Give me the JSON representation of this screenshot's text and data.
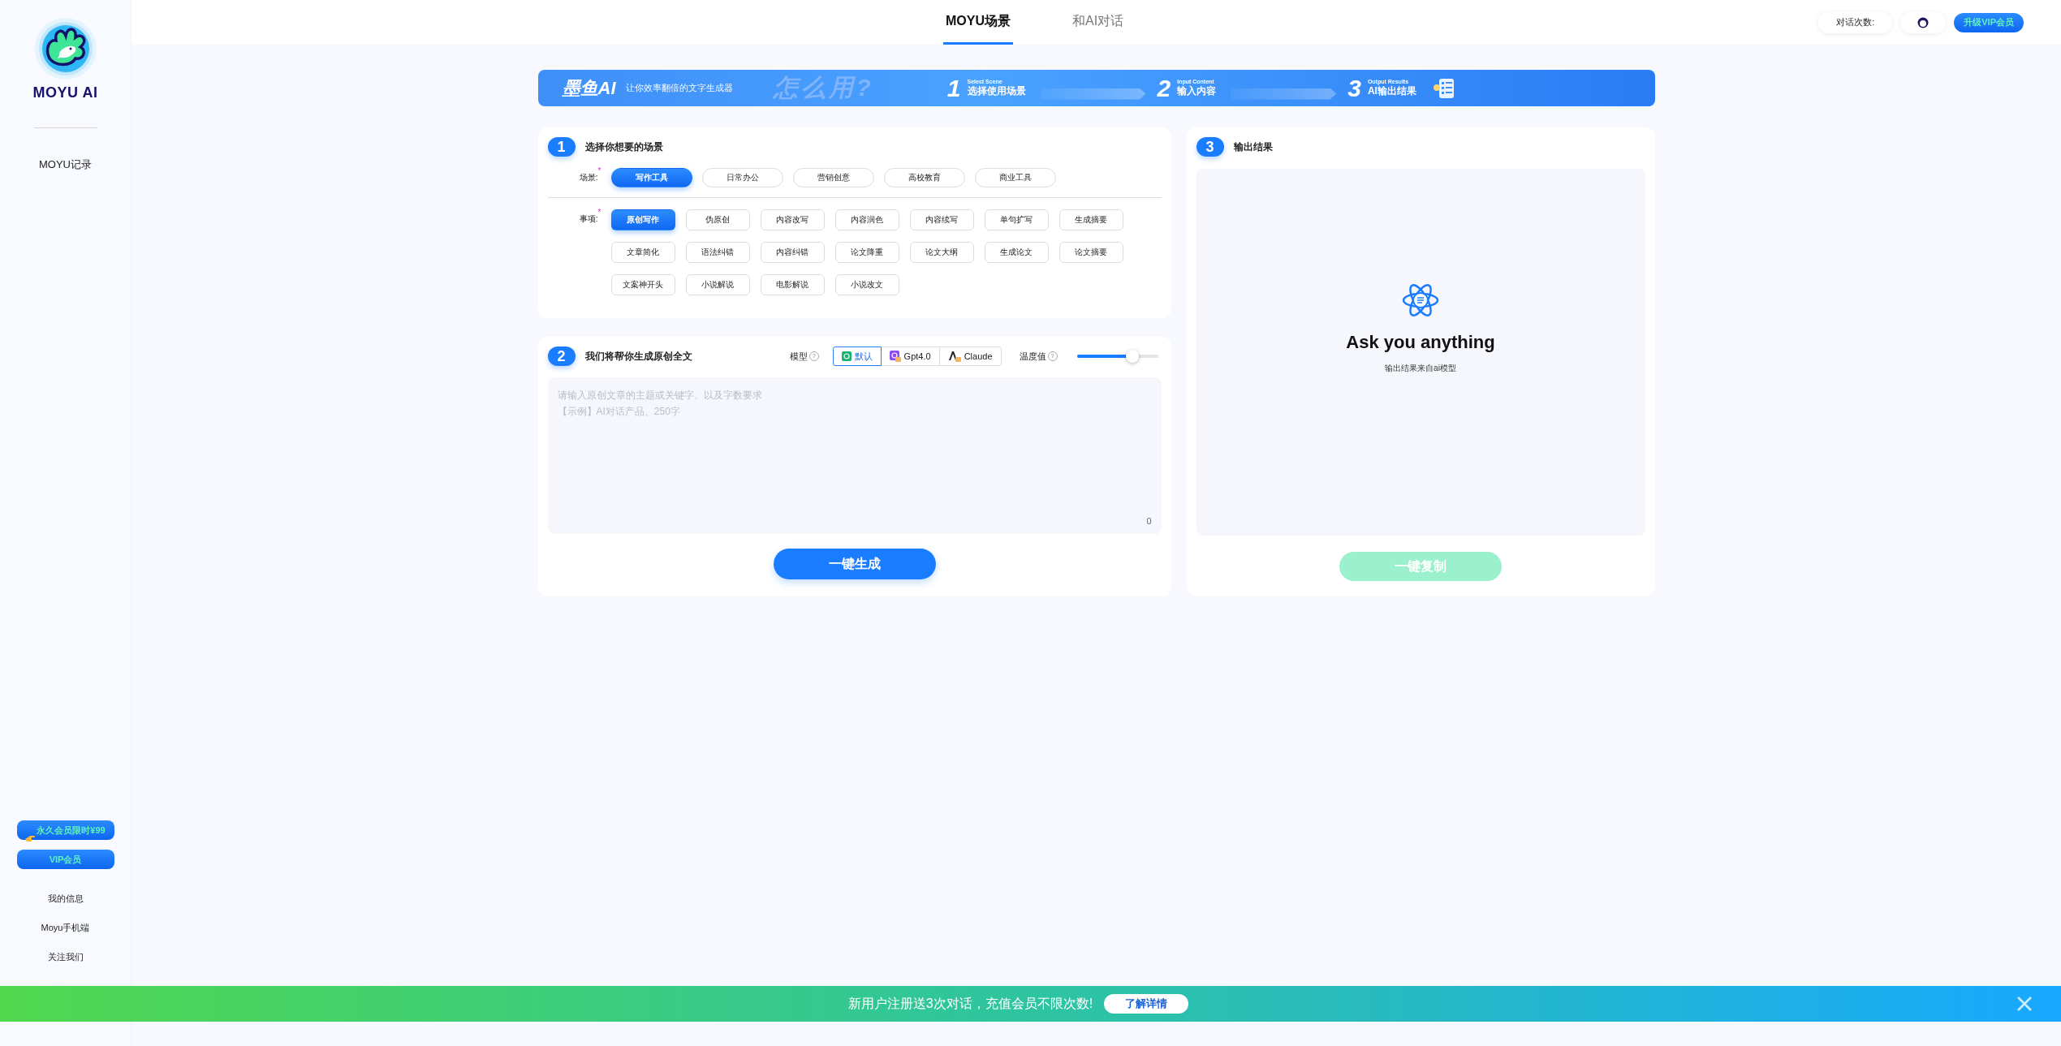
{
  "sidebar": {
    "logo_text": "MOYU AI",
    "items": [
      {
        "label": "MOYU记录"
      }
    ],
    "promo_buttons": [
      {
        "label": "永久会员限时¥99",
        "kind": "pointer"
      },
      {
        "label": "VIP会员",
        "kind": "plain"
      }
    ],
    "links": [
      "我的信息",
      "Moyu手机端",
      "关注我们"
    ]
  },
  "header": {
    "tabs": [
      {
        "label": "MOYU场景",
        "selected": true
      },
      {
        "label": "和AI对话",
        "selected": false
      }
    ],
    "chat_count_label": "对话次数:",
    "upgrade_button": "升级VIP会员"
  },
  "banner": {
    "brand": "墨鱼AI",
    "tagline": "让你效率翻倍的文字生成器",
    "how_to": "怎么用?",
    "steps": [
      {
        "number": "1",
        "subtitle": "Select Scene",
        "title": "选择使用场景"
      },
      {
        "number": "2",
        "subtitle": "Input Content",
        "title": "输入内容"
      },
      {
        "number": "3",
        "subtitle": "Output Results",
        "title": "AI输出结果"
      }
    ]
  },
  "scene_panel": {
    "step": "1",
    "title": "选择你想要的场景",
    "scene_label": "场景:",
    "required_mark": "*",
    "scenes": [
      {
        "label": "写作工具",
        "selected": true
      },
      {
        "label": "日常办公",
        "selected": false
      },
      {
        "label": "营销创意",
        "selected": false
      },
      {
        "label": "高校教育",
        "selected": false
      },
      {
        "label": "商业工具",
        "selected": false
      }
    ],
    "item_label": "事项:",
    "item_required_mark": "*",
    "items": [
      {
        "label": "原创写作",
        "selected": true
      },
      {
        "label": "伪原创",
        "selected": false
      },
      {
        "label": "内容改写",
        "selected": false
      },
      {
        "label": "内容润色",
        "selected": false
      },
      {
        "label": "内容续写",
        "selected": false
      },
      {
        "label": "单句扩写",
        "selected": false
      },
      {
        "label": "生成摘要",
        "selected": false
      },
      {
        "label": "文章简化",
        "selected": false
      },
      {
        "label": "语法纠错",
        "selected": false
      },
      {
        "label": "内容纠错",
        "selected": false
      },
      {
        "label": "论文降重",
        "selected": false
      },
      {
        "label": "论文大纲",
        "selected": false
      },
      {
        "label": "生成论文",
        "selected": false
      },
      {
        "label": "论文摘要",
        "selected": false
      },
      {
        "label": "文案神开头",
        "selected": false
      },
      {
        "label": "小说解说",
        "selected": false
      },
      {
        "label": "电影解说",
        "selected": false
      },
      {
        "label": "小说改文",
        "selected": false
      }
    ]
  },
  "input_panel": {
    "step": "2",
    "title": "我们将帮你生成原创全文",
    "model_label": "模型",
    "model_hint": "?",
    "models": [
      {
        "label": "默认",
        "selected": true,
        "kind": "default"
      },
      {
        "label": "Gpt4.0",
        "selected": false,
        "kind": "gpt"
      },
      {
        "label": "Claude",
        "selected": false,
        "kind": "claude"
      }
    ],
    "temperature_label": "温度值",
    "temperature_hint": "?",
    "temperature": {
      "level": 0.63
    },
    "placeholder_lines": [
      "请输入原创文章的主题或关键字、以及字数要求",
      "【示例】AI对话产品、250字"
    ],
    "char_count": "0",
    "generate_button": "一键生成"
  },
  "output_panel": {
    "step": "3",
    "title": "输出结果",
    "heading": "Ask you anything",
    "subtext": "输出结果来自ai模型",
    "copy_button": {
      "label": "一键复制",
      "disabled": true
    }
  },
  "notice_bar": {
    "text": "新用户注册送3次对话，充值会员不限次数!",
    "details_button": "了解详情"
  }
}
